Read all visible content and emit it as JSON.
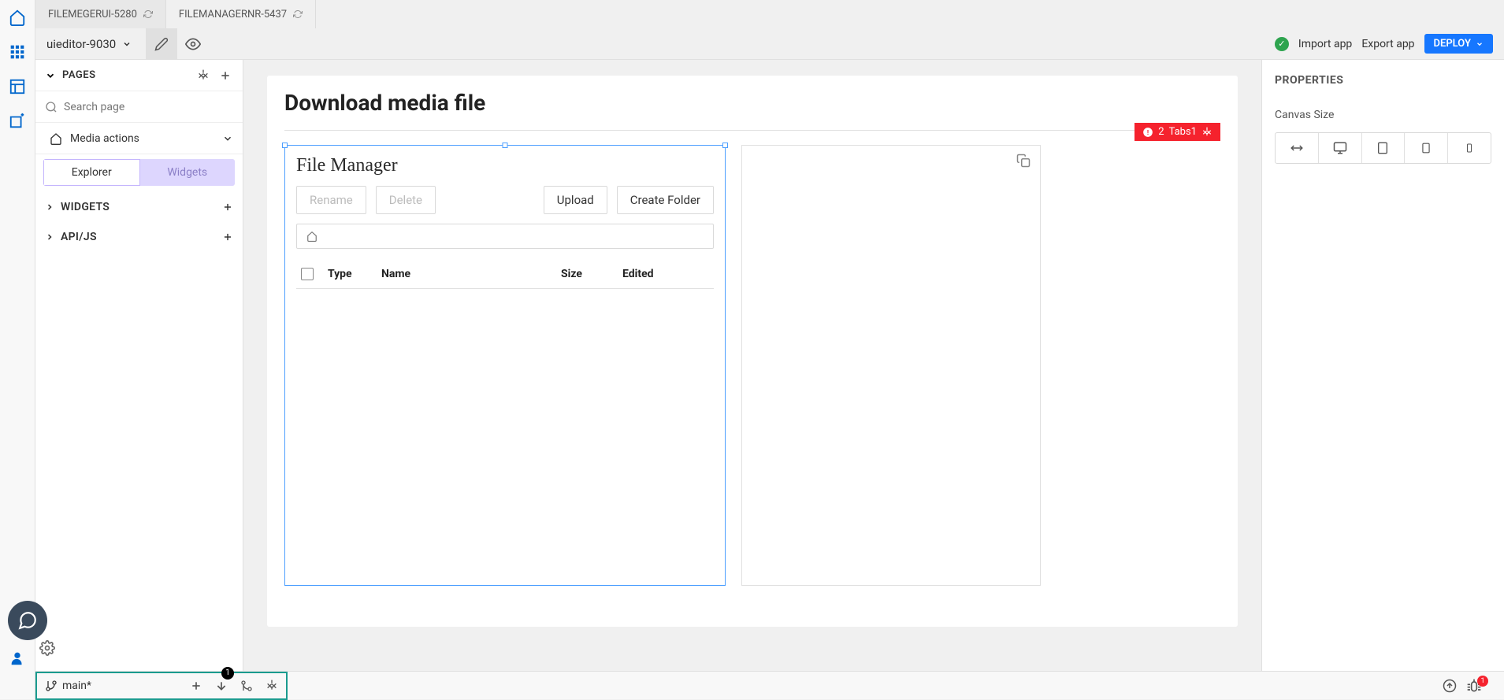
{
  "tabs": [
    {
      "label": "FILEMEGERUI-5280",
      "active": true
    },
    {
      "label": "FILEMANAGERNR-5437",
      "active": false
    }
  ],
  "app_selector": {
    "name": "uieditor-9030"
  },
  "header": {
    "import": "Import app",
    "export": "Export app",
    "deploy": "DEPLOY"
  },
  "left_panel": {
    "pages_title": "PAGES",
    "search_placeholder": "Search page",
    "page_item": "Media actions",
    "segment": {
      "explorer": "Explorer",
      "widgets": "Widgets"
    },
    "widgets_title": "WIDGETS",
    "apijs_title": "API/JS"
  },
  "canvas": {
    "title": "Download media file",
    "error_badge": {
      "count": "2",
      "name": "Tabs1"
    },
    "file_manager": {
      "title": "File Manager",
      "buttons": {
        "rename": "Rename",
        "delete": "Delete",
        "upload": "Upload",
        "create_folder": "Create Folder"
      },
      "columns": {
        "type": "Type",
        "name": "Name",
        "size": "Size",
        "edited": "Edited"
      }
    }
  },
  "props": {
    "title": "PROPERTIES",
    "canvas_size_label": "Canvas Size"
  },
  "git": {
    "branch": "main*",
    "badge": "1"
  },
  "bottom": {
    "bug_count": "1"
  }
}
